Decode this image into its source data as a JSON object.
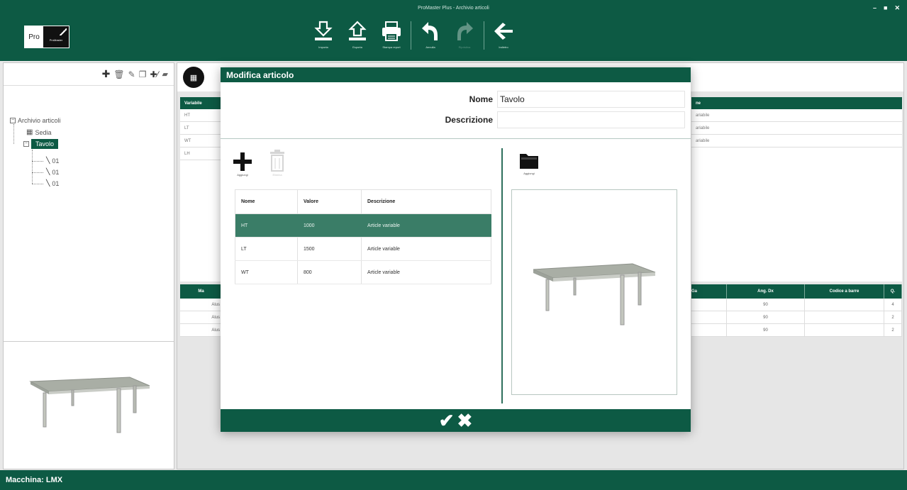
{
  "window": {
    "title": "ProMaster Plus - Archivio articoli",
    "controls": [
      "–",
      "■",
      "✕"
    ]
  },
  "logo": {
    "pro": "Pro",
    "sub": "ProMaster"
  },
  "toolbar": {
    "items": [
      {
        "label": "Importa",
        "icon": "import-icon",
        "enabled": true
      },
      {
        "label": "Esporta",
        "icon": "export-icon",
        "enabled": true
      },
      {
        "label": "Stampa report",
        "icon": "printer-icon",
        "enabled": true
      },
      {
        "label": "Annulla",
        "icon": "undo-icon",
        "enabled": true
      },
      {
        "label": "Ripristina",
        "icon": "redo-icon",
        "enabled": false
      },
      {
        "label": "Indietro",
        "icon": "back-arrow-icon",
        "enabled": true
      }
    ]
  },
  "left_tools": [
    "plus-icon",
    "trash-icon",
    "pencil-icon",
    "copy-icon",
    "add-variable-icon",
    "folder-icon"
  ],
  "tree": {
    "root": "Archivio articoli",
    "items": [
      {
        "label": "Sedia",
        "level": 1
      },
      {
        "label": "Tavolo",
        "level": 1,
        "selected": true
      },
      {
        "label": "01",
        "level": 2
      },
      {
        "label": "01",
        "level": 2
      },
      {
        "label": "01",
        "level": 2
      }
    ]
  },
  "background_table": {
    "header": "Variabile",
    "rows": [
      "HT",
      "LT",
      "WT",
      "LH"
    ],
    "right_header": "ne",
    "right_rows": [
      "ariabile",
      "ariabile",
      "ariabile"
    ]
  },
  "background_table2": {
    "headers": [
      "Ma",
      "Ga",
      "Ang. Dx",
      "Codice a barre",
      "Q."
    ],
    "rows": [
      [
        "Alus",
        "",
        "90",
        "",
        "4"
      ],
      [
        "Alus",
        "",
        "90",
        "",
        "2"
      ],
      [
        "Alus",
        "",
        "90",
        "",
        "2"
      ]
    ]
  },
  "status": {
    "text": "Macchina:  LMX"
  },
  "modal": {
    "title": "Modifica articolo",
    "name_label": "Nome",
    "name_value": "Tavolo",
    "description_label": "Descrizione",
    "description_value": "",
    "add_label": "Aggiungi",
    "delete_label": "Elimina",
    "image_add_label": "Aggiungi",
    "columns": [
      "Nome",
      "Valore",
      "Descrizione"
    ],
    "variables": [
      {
        "name": "HT",
        "value": "1000",
        "desc": "Article variable",
        "selected": true
      },
      {
        "name": "LT",
        "value": "1500",
        "desc": "Article variable",
        "selected": false
      },
      {
        "name": "WT",
        "value": "800",
        "desc": "Article variable",
        "selected": false
      }
    ],
    "confirm_glyph": "✔",
    "cancel_glyph": "✖"
  },
  "colors": {
    "brand": "#0d5a44",
    "selected_row": "#3a7d67"
  }
}
